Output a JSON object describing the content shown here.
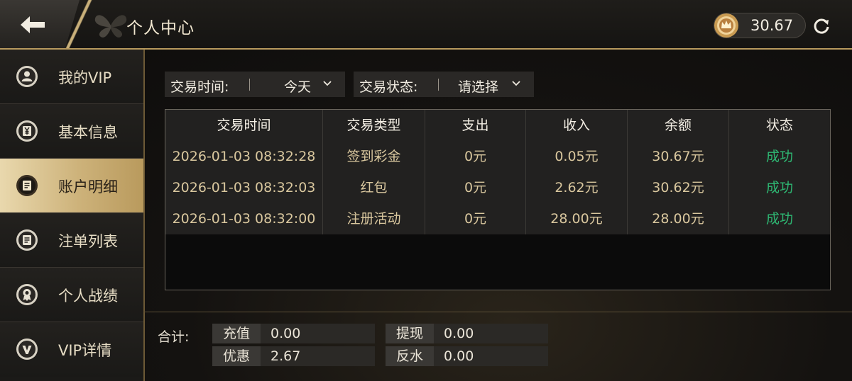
{
  "header": {
    "title": "个人中心",
    "balance": "30.67",
    "icons": {
      "back": "back-arrow-icon",
      "coin": "crown-coin-icon",
      "refresh": "refresh-icon"
    }
  },
  "sidebar": {
    "items": [
      {
        "label": "我的VIP",
        "icon": "user-icon",
        "active": false
      },
      {
        "label": "基本信息",
        "icon": "yen-card-icon",
        "active": false
      },
      {
        "label": "账户明细",
        "icon": "ledger-icon",
        "active": true
      },
      {
        "label": "注单列表",
        "icon": "list-icon",
        "active": false
      },
      {
        "label": "个人战绩",
        "icon": "medal-icon",
        "active": false
      },
      {
        "label": "VIP详情",
        "icon": "vip-v-icon",
        "active": false
      }
    ]
  },
  "filters": {
    "time_label": "交易时间:",
    "time_value": "今天",
    "status_label": "交易状态:",
    "status_value": "请选择"
  },
  "table": {
    "headers": [
      "交易时间",
      "交易类型",
      "支出",
      "收入",
      "余额",
      "状态"
    ],
    "rows": [
      [
        "2026-01-03 08:32:28",
        "签到彩金",
        "0元",
        "0.05元",
        "30.67元",
        "成功"
      ],
      [
        "2026-01-03 08:32:03",
        "红包",
        "0元",
        "2.62元",
        "30.62元",
        "成功"
      ],
      [
        "2026-01-03 08:32:00",
        "注册活动",
        "0元",
        "28.00元",
        "28.00元",
        "成功"
      ]
    ]
  },
  "summary": {
    "label": "合计:",
    "recharge_key": "充值",
    "recharge_value": "0.00",
    "withdraw_key": "提现",
    "withdraw_value": "0.00",
    "discount_key": "优惠",
    "discount_value": "2.67",
    "rebate_key": "反水",
    "rebate_value": "0.00"
  },
  "colors": {
    "accent_gold": "#c9b07a",
    "success": "#2eb873",
    "amount_text": "#d9c79e"
  }
}
